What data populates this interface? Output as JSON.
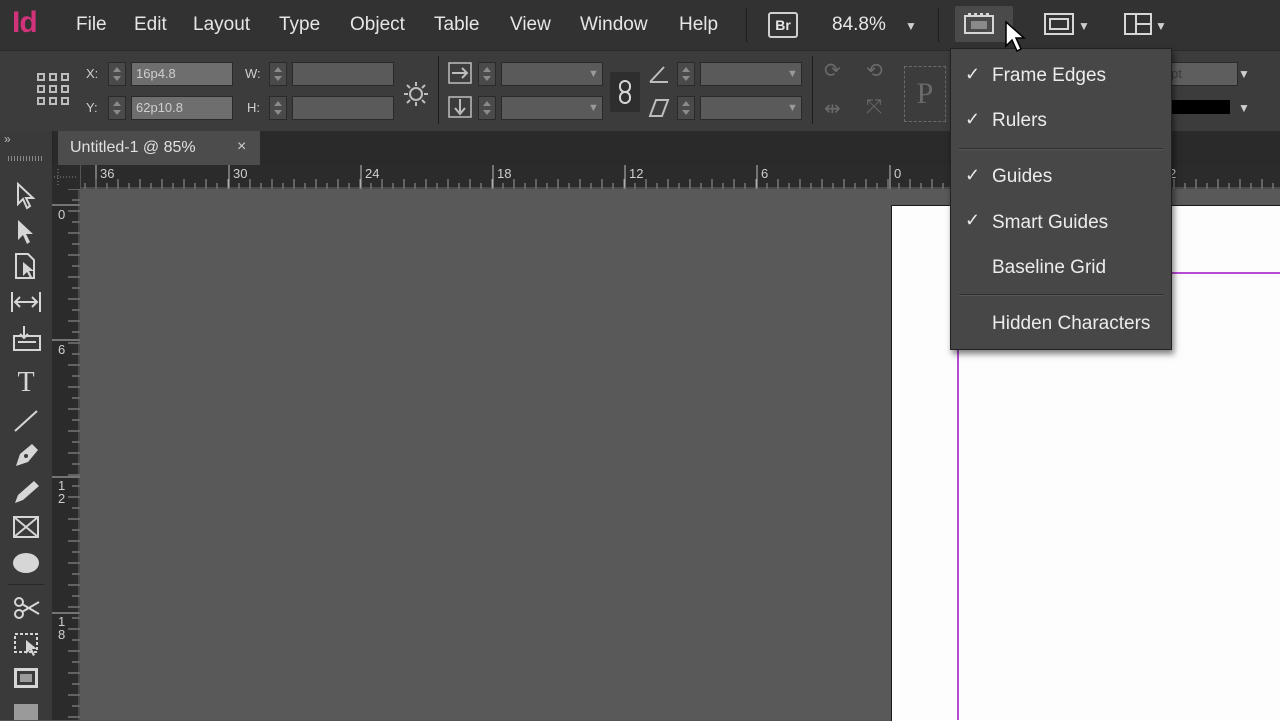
{
  "app": {
    "logo": "Id"
  },
  "menu": [
    "File",
    "Edit",
    "Layout",
    "Type",
    "Object",
    "Table",
    "View",
    "Window",
    "Help"
  ],
  "toolbar": {
    "bridge_label": "Br",
    "zoom": "84.8%"
  },
  "control_panel": {
    "x_label": "X:",
    "x_value": "16p4.8",
    "y_label": "Y:",
    "y_value": "62p10.8",
    "w_label": "W:",
    "h_label": "H:",
    "partial_text": "pt"
  },
  "document": {
    "tab_title": "Untitled-1 @ 85%",
    "close_glyph": "×"
  },
  "rulers": {
    "horizontal": [
      "36",
      "30",
      "24",
      "18",
      "12",
      "6",
      "0",
      "2"
    ],
    "vertical": [
      "0",
      "6",
      "1 2",
      "1 8"
    ]
  },
  "view_menu": {
    "items": [
      {
        "label": "Frame Edges",
        "checked": true
      },
      {
        "label": "Rulers",
        "checked": true
      },
      {
        "label": "Guides",
        "checked": true
      },
      {
        "label": "Smart Guides",
        "checked": true
      },
      {
        "label": "Baseline Grid",
        "checked": false
      },
      {
        "label": "Hidden Characters",
        "checked": false
      }
    ],
    "check_glyph": "✓"
  },
  "colors": {
    "logo": "#d1337a",
    "margin_guide": "#b64bd4",
    "page": "#fdfdfd",
    "pasteboard": "#595959"
  },
  "icons": [
    "selection-tool-icon",
    "direct-selection-tool-icon",
    "page-tool-icon",
    "gap-tool-icon",
    "content-collector-icon",
    "type-tool-icon",
    "line-tool-icon",
    "pen-tool-icon",
    "pencil-tool-icon",
    "rectangle-frame-tool-icon",
    "ellipse-tool-icon",
    "scissors-tool-icon",
    "free-transform-tool-icon",
    "gradient-swatch-tool-icon",
    "screen-mode-icon",
    "arrange-documents-icon",
    "workspace-icon"
  ]
}
